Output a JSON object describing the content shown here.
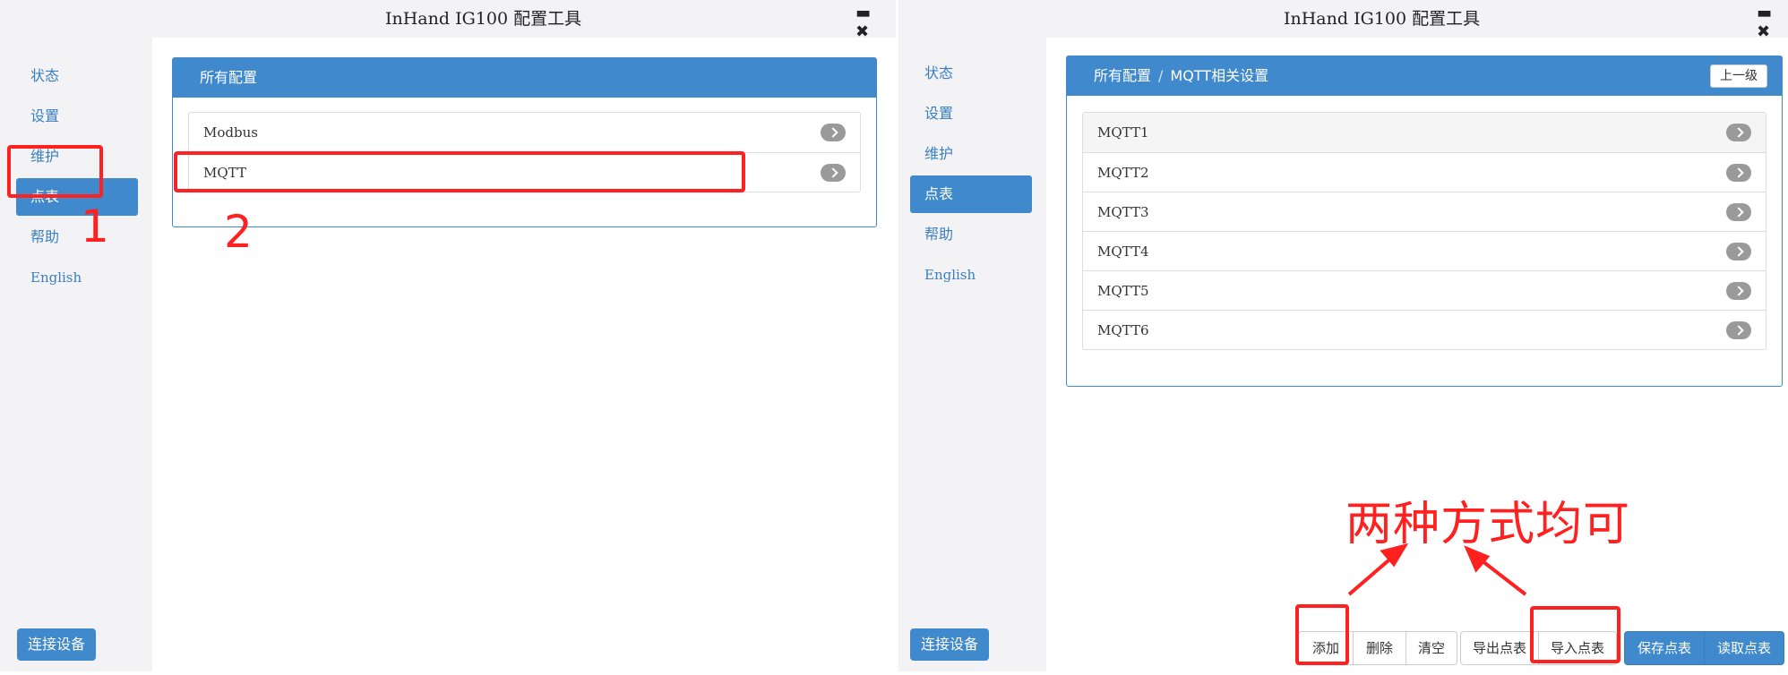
{
  "left_window": {
    "title": "InHand IG100 配置工具",
    "controls": {
      "minimize": "▬",
      "close": "✖"
    },
    "nav": [
      "状态",
      "设置",
      "维护",
      "点表",
      "帮助",
      "English"
    ],
    "active_nav": "点表",
    "connect_button": "连接设备",
    "panel": {
      "heading": "所有配置",
      "items": [
        "Modbus",
        "MQTT"
      ]
    }
  },
  "right_window": {
    "title": "InHand IG100 配置工具",
    "controls": {
      "minimize": "▬",
      "close": "✖"
    },
    "nav": [
      "状态",
      "设置",
      "维护",
      "点表",
      "帮助",
      "English"
    ],
    "active_nav": "点表",
    "connect_button": "连接设备",
    "panel": {
      "breadcrumb": [
        "所有配置",
        "MQTT相关设置"
      ],
      "breadcrumb_separator": "/",
      "up_button": "上一级",
      "items": [
        "MQTT1",
        "MQTT2",
        "MQTT3",
        "MQTT4",
        "MQTT5",
        "MQTT6"
      ]
    },
    "buttons": {
      "add": "添加",
      "delete": "删除",
      "clear": "清空",
      "export": "导出点表",
      "import": "导入点表",
      "save": "保存点表",
      "read": "读取点表"
    }
  },
  "annotations": {
    "step1": "1",
    "step2": "2",
    "note": "两种方式均可",
    "color": "#ff2020"
  },
  "colors": {
    "accent": "#4089cc",
    "sidebar_bg": "#f3f3f5",
    "annotation": "#ff2020"
  }
}
